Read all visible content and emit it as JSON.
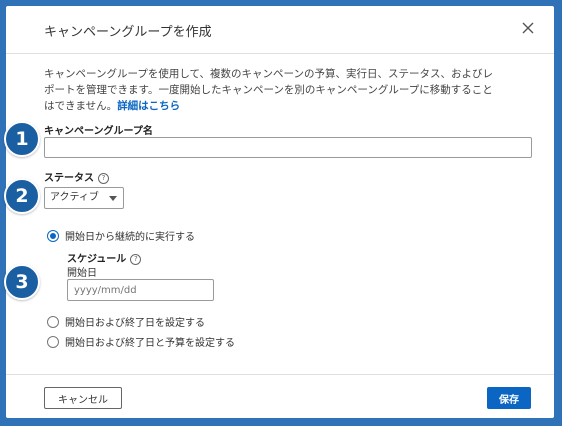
{
  "dialog": {
    "title": "キャンペーングループを作成",
    "description_line1": "キャンペーングループを使用して、複数のキャンペーンの予算、実行日、ステータス、およびレ",
    "description_line2": "ポートを管理できます。一度開始したキャンペーンを別のキャンペーングループに移動すること",
    "description_line3": "はできません。",
    "details_link": "詳細はこちら",
    "name_label": "キャンペーングループ名",
    "name_value": "",
    "status_label": "ステータス",
    "status_help": "?",
    "status_value": "アクティブ",
    "radio_continuous": "開始日から継続的に実行する",
    "schedule_label": "スケジュール",
    "schedule_help": "?",
    "start_date_label": "開始日",
    "start_date_placeholder": "yyyy/mm/dd",
    "radio_end_date": "開始日および終了日を設定する",
    "radio_end_budget": "開始日および終了日と予算を設定する",
    "cancel_label": "キャンセル",
    "save_label": "保存"
  },
  "badges": [
    "1",
    "2",
    "3"
  ],
  "colors": {
    "accent": "#0a66c2",
    "frame": "#2f72b8",
    "badge": "#1b5fa3"
  }
}
